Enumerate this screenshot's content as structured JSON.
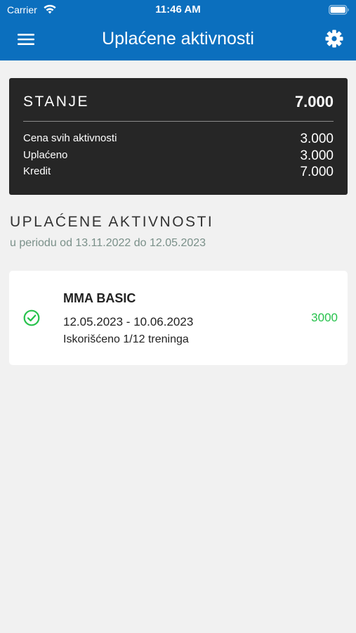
{
  "status_bar": {
    "carrier": "Carrier",
    "time": "11:46 AM"
  },
  "header": {
    "title": "Uplaćene aktivnosti",
    "menu_icon": "hamburger-menu-icon",
    "settings_icon": "gear-icon",
    "background_color": "#0b6fbe"
  },
  "balance": {
    "label": "STANJE",
    "value": "7.000",
    "rows": [
      {
        "label": "Cena svih aktivnosti",
        "value": "3.000"
      },
      {
        "label": "Uplaćeno",
        "value": "3.000"
      },
      {
        "label": "Kredit",
        "value": "7.000"
      }
    ]
  },
  "section": {
    "title": "UPLAĆENE AKTIVNOSTI",
    "subtitle": "u periodu od 13.11.2022 do 12.05.2023"
  },
  "activities": [
    {
      "name": "MMA BASIC",
      "dates": "12.05.2023 - 10.06.2023",
      "usage": "Iskorišćeno 1/12 treninga",
      "amount": "3000",
      "status_icon": "check-circle-icon",
      "amount_color": "#27c24c"
    }
  ]
}
